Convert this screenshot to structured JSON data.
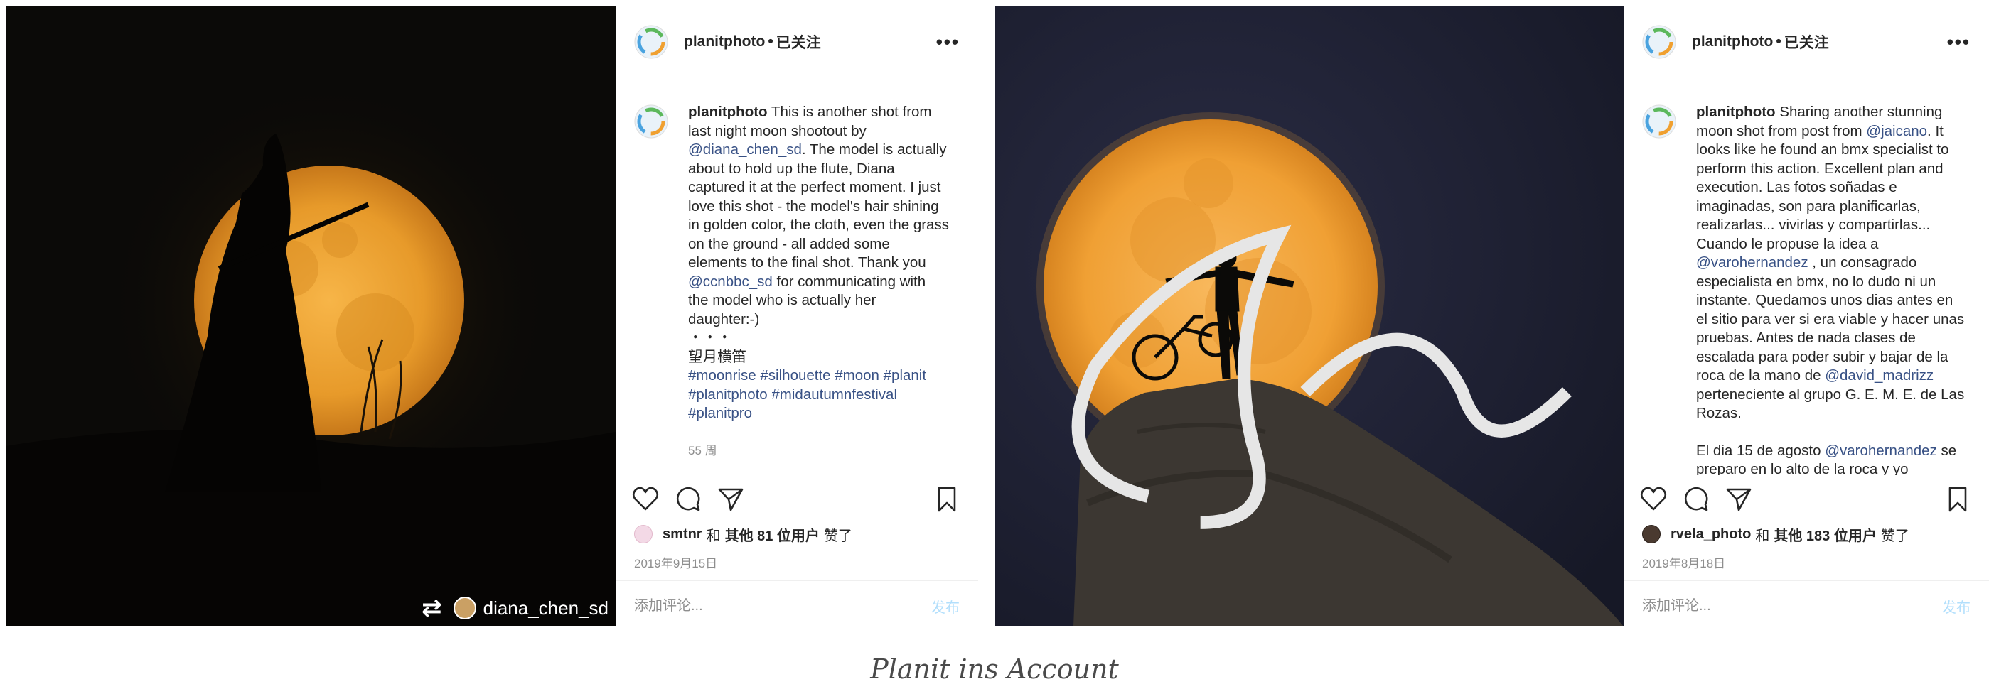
{
  "colors": {
    "link": "#385185",
    "muted": "#8e8e8e",
    "post_disabled": "#b2dffc",
    "moon": "#f2a030",
    "sky": "#12131e"
  },
  "post1": {
    "repost_user": "diana_chen_sd",
    "header": {
      "username": "planitphoto",
      "separator": "•",
      "follow": "已关注",
      "more": "•••"
    },
    "caption": {
      "username": "planitphoto",
      "t1": " This is another shot from last night moon shootout by ",
      "m1": "@diana_chen_sd",
      "t2": ". The model is actually about to hold up the flute, Diana captured it at the perfect moment. I just love this shot - the model's hair shining in golden color, the cloth, even the grass on the ground - all added some elements to the final shot. Thank you ",
      "m2": "@ccnbbc_sd",
      "t3": " for communicating with the model who is actually her daughter:-)",
      "dots": "・・・",
      "cn": "望月横笛",
      "tags": "#moonrise #silhouette #moon #planit #planitphoto #midautumnfestival #planitpro"
    },
    "time_ago": "55 周",
    "likes": {
      "user": "smtnr",
      "and": "和",
      "others": "其他 81 位用户",
      "liked": "赞了"
    },
    "date": "2019年9月15日",
    "comment": {
      "placeholder": "添加评论...",
      "post": "发布"
    }
  },
  "post2": {
    "header": {
      "username": "planitphoto",
      "separator": "•",
      "follow": "已关注",
      "more": "•••"
    },
    "caption": {
      "username": "planitphoto",
      "t1": " Sharing another stunning moon shot from post from ",
      "m1": "@jaicano",
      "t2": ". It looks like he found an bmx specialist to perform this action. Excellent plan and execution. Las fotos soñadas e imaginadas, son para planificarlas, realizarlas... vivirlas y compartirlas... Cuando le propuse la idea a ",
      "m2": "@varohernandez",
      "t3": " , un consagrado especialista en bmx, no lo dudo ni un instante. Quedamos unos dias antes en el sitio para ver si era viable y hacer unas pruebas. Antes de nada clases de escalada para poder subir y bajar de la roca de la mano de ",
      "m3": "@david_madrizz",
      "t4": " perteneciente al grupo G. E. M. E. de Las Rozas.",
      "p2a": "El dia 15 de agosto ",
      "m4": "@varohernandez",
      "p2b": " se preparo en lo alto de la roca y yo"
    },
    "likes": {
      "user": "rvela_photo",
      "and": "和",
      "others": "其他 183 位用户",
      "liked": "赞了"
    },
    "date": "2019年8月18日",
    "comment": {
      "placeholder": "添加评论...",
      "post": "发布"
    }
  },
  "page_caption": "Planit ins Account"
}
